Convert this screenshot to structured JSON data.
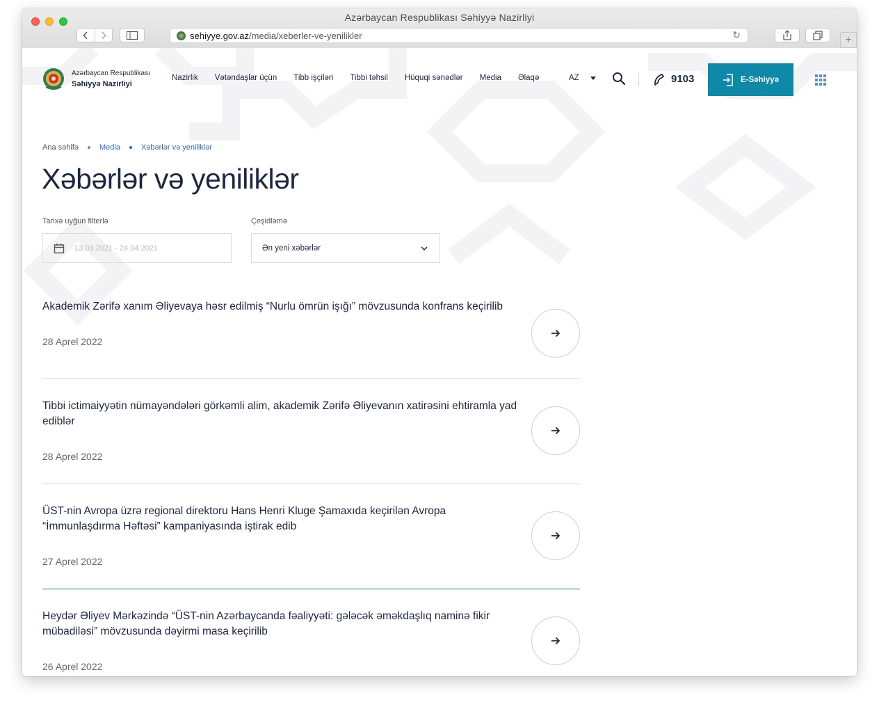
{
  "window": {
    "title": "Azərbaycan Respublikası Səhiyyə Nazirliyi",
    "url_host": "sehiyye.gov.az",
    "url_path": "/media/xeberler-ve-yenilikler"
  },
  "header": {
    "logo_line1": "Azərbaycan Respublikası",
    "logo_line2": "Səhiyyə Nazirliyi",
    "nav": [
      "Nazirlik",
      "Vətəndaşlar üçün",
      "Tibb işçiləri",
      "Tibbi təhsil",
      "Hüquqi sənədlər",
      "Media",
      "Əlaqə"
    ],
    "language": "AZ",
    "phone": "9103",
    "ehealth_label": "E-Səhiyyə"
  },
  "breadcrumb": {
    "home": "Ana səhifə",
    "media": "Media",
    "current": "Xəbərlər və yeniliklər"
  },
  "page_title": "Xəbərlər və yeniliklər",
  "filters": {
    "date_label": "Tarixə uyğun filterlə",
    "date_placeholder": "13.03.2021 - 24.04.2021",
    "sort_label": "Çeşidləmə",
    "sort_value": "Ən yeni xəbərlər"
  },
  "news": [
    {
      "title": "Akademik Zərifə xanım Əliyevaya həsr edilmiş “Nurlu ömrün işığı” mövzusunda konfrans keçirilib",
      "date": "28 Aprel 2022"
    },
    {
      "title": "Tibbi ictimaiyyətin nümayəndələri görkəmli alim, akademik Zərifə Əliyevanın xatirəsini ehtiramla yad ediblər",
      "date": "28 Aprel 2022"
    },
    {
      "title": "ÜST-nin Avropa üzrə regional direktoru Hans Henri Kluge Şamaxıda keçirilən Avropa “İmmunlaşdırma Həftəsi” kampaniyasında iştirak edib",
      "date": "27 Aprel 2022"
    },
    {
      "title": "Heydər Əliyev Mərkəzində “ÜST-nin Azərbaycanda fəaliyyəti: gələcək əməkdaşlıq naminə fikir mübadiləsi” mövzusunda dəyirmi masa keçirilib",
      "date": "26 Aprel 2022"
    }
  ],
  "colors": {
    "accent": "#0e8aa8",
    "link": "#2f6cc0",
    "text": "#1b2741"
  }
}
